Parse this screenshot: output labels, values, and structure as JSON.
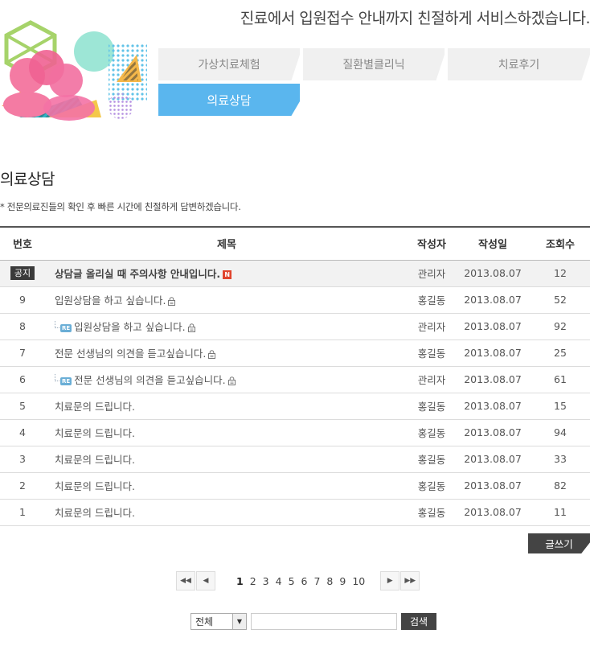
{
  "header": {
    "slogan": "진료에서 입원접수 안내까지 친절하게 서비스하겠습니다."
  },
  "menu": {
    "tabs": [
      {
        "label": "가상치료체험"
      },
      {
        "label": "질환별클리닉"
      },
      {
        "label": "치료후기"
      }
    ],
    "active_tab": "의료상담",
    "active_color": "#5ab6ee"
  },
  "page": {
    "title": "의료상담",
    "description": "* 전문의료진들의 확인 후 빠른 시간에 친절하게 답변하겠습니다."
  },
  "table": {
    "headers": {
      "no": "번호",
      "subject": "제목",
      "writer": "작성자",
      "date": "작성일",
      "hits": "조회수"
    },
    "notice": {
      "badge": "공지",
      "subject": "상담글 올리실 때 주의사항 안내입니다.",
      "new_badge": "N",
      "writer": "관리자",
      "date": "2013.08.07",
      "hits": "12"
    },
    "rows": [
      {
        "no": "9",
        "subject": "입원상담을 하고 싶습니다.",
        "writer": "홍길동",
        "date": "2013.08.07",
        "hits": "52",
        "locked": true,
        "reply": false
      },
      {
        "no": "8",
        "subject": "입원상담을 하고 싶습니다.",
        "writer": "관리자",
        "date": "2013.08.07",
        "hits": "92",
        "locked": true,
        "reply": true
      },
      {
        "no": "7",
        "subject": "전문 선생님의 의견을 듣고싶습니다.",
        "writer": "홍길동",
        "date": "2013.08.07",
        "hits": "25",
        "locked": true,
        "reply": false
      },
      {
        "no": "6",
        "subject": "전문 선생님의 의견을 듣고싶습니다.",
        "writer": "관리자",
        "date": "2013.08.07",
        "hits": "61",
        "locked": true,
        "reply": true
      },
      {
        "no": "5",
        "subject": "치료문의 드립니다.",
        "writer": "홍길동",
        "date": "2013.08.07",
        "hits": "15",
        "locked": false,
        "reply": false
      },
      {
        "no": "4",
        "subject": "치료문의 드립니다.",
        "writer": "홍길동",
        "date": "2013.08.07",
        "hits": "94",
        "locked": false,
        "reply": false
      },
      {
        "no": "3",
        "subject": "치료문의 드립니다.",
        "writer": "홍길동",
        "date": "2013.08.07",
        "hits": "33",
        "locked": false,
        "reply": false
      },
      {
        "no": "2",
        "subject": "치료문의 드립니다.",
        "writer": "홍길동",
        "date": "2013.08.07",
        "hits": "82",
        "locked": false,
        "reply": false
      },
      {
        "no": "1",
        "subject": "치료문의 드립니다.",
        "writer": "홍길동",
        "date": "2013.08.07",
        "hits": "11",
        "locked": false,
        "reply": false
      }
    ],
    "reply_badge": "RE"
  },
  "actions": {
    "write_label": "글쓰기"
  },
  "pagination": {
    "first_icon": "double-chevron-left-icon",
    "prev_icon": "chevron-left-icon",
    "next_icon": "chevron-right-icon",
    "last_icon": "double-chevron-right-icon",
    "pages": [
      "1",
      "2",
      "3",
      "4",
      "5",
      "6",
      "7",
      "8",
      "9",
      "10"
    ],
    "current": "1"
  },
  "search": {
    "select_value": "전체",
    "input_value": "",
    "button_label": "검색"
  }
}
